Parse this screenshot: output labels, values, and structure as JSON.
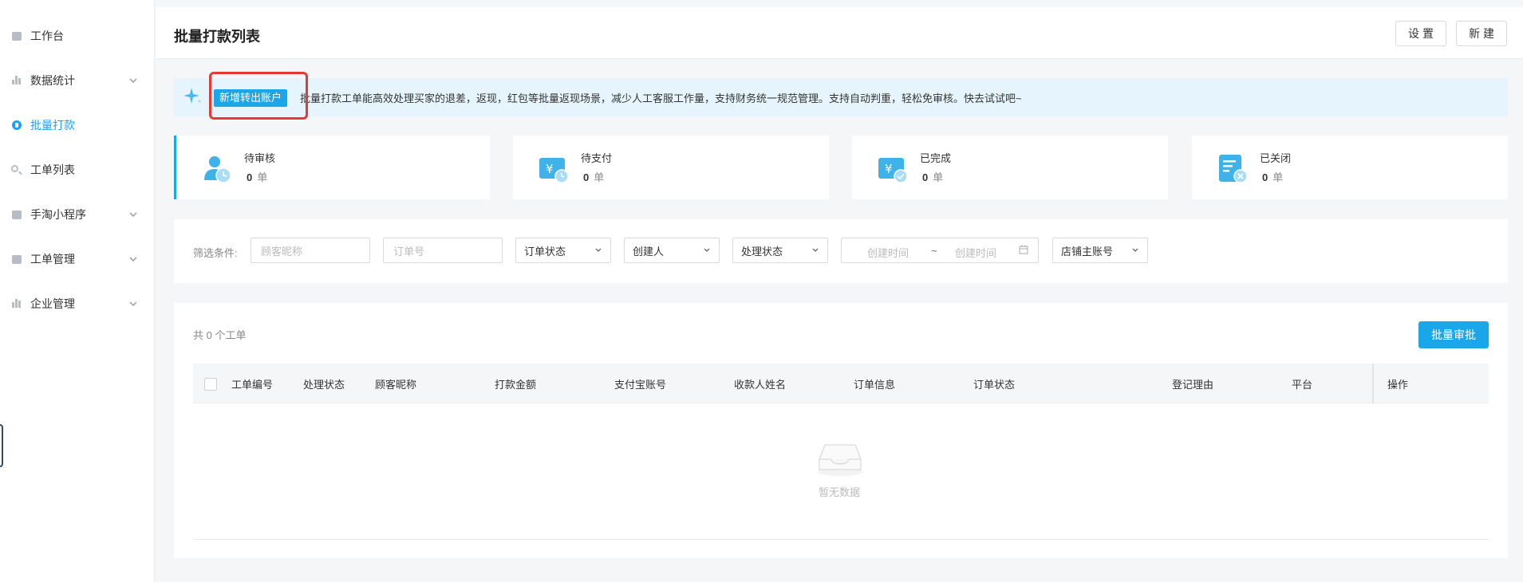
{
  "sidebar": {
    "items": [
      {
        "label": "工作台",
        "icon": "desk-icon",
        "has_chevron": false
      },
      {
        "label": "数据统计",
        "icon": "bar-chart-icon",
        "has_chevron": true
      },
      {
        "label": "批量打款",
        "icon": "money-icon",
        "has_chevron": false,
        "active": true
      },
      {
        "label": "工单列表",
        "icon": "search-icon",
        "has_chevron": false
      },
      {
        "label": "手淘小程序",
        "icon": "clipboard-icon",
        "has_chevron": true
      },
      {
        "label": "工单管理",
        "icon": "document-icon",
        "has_chevron": true
      },
      {
        "label": "企业管理",
        "icon": "building-icon",
        "has_chevron": true
      }
    ]
  },
  "header": {
    "title": "批量打款列表",
    "settings_label": "设置",
    "new_label": "新建"
  },
  "banner": {
    "tag_label": "新增转出账户",
    "text": "批量打款工单能高效处理买家的退差，返现，红包等批量返现场景，减少人工客服工作量，支持财务统一规范管理。支持自动判重，轻松免审核。快去试试吧~"
  },
  "stats": [
    {
      "label": "待审核",
      "count": "0",
      "unit": "单",
      "icon": "pending-review-icon"
    },
    {
      "label": "待支付",
      "count": "0",
      "unit": "单",
      "icon": "pending-payment-icon"
    },
    {
      "label": "已完成",
      "count": "0",
      "unit": "单",
      "icon": "completed-icon"
    },
    {
      "label": "已关闭",
      "count": "0",
      "unit": "单",
      "icon": "closed-icon"
    }
  ],
  "filters": {
    "label": "筛选条件:",
    "customer_nickname_placeholder": "顾客昵称",
    "order_number_placeholder": "订单号",
    "order_status": "订单状态",
    "creator": "创建人",
    "process_status": "处理状态",
    "created_time_start": "创建时间",
    "range_separator": "~",
    "created_time_end": "创建时间",
    "shop_account": "店铺主账号"
  },
  "table": {
    "total_text": "共 0 个工单",
    "batch_approve_label": "批量审批",
    "columns": [
      "工单编号",
      "处理状态",
      "顾客昵称",
      "打款金额",
      "支付宝账号",
      "收款人姓名",
      "订单信息",
      "订单状态",
      "登记理由",
      "平台",
      "操作"
    ],
    "empty_text": "暂无数据"
  },
  "colors": {
    "accent": "#1aa7ea",
    "highlight_border": "#e53935",
    "banner_bg": "#e6f5fd"
  }
}
